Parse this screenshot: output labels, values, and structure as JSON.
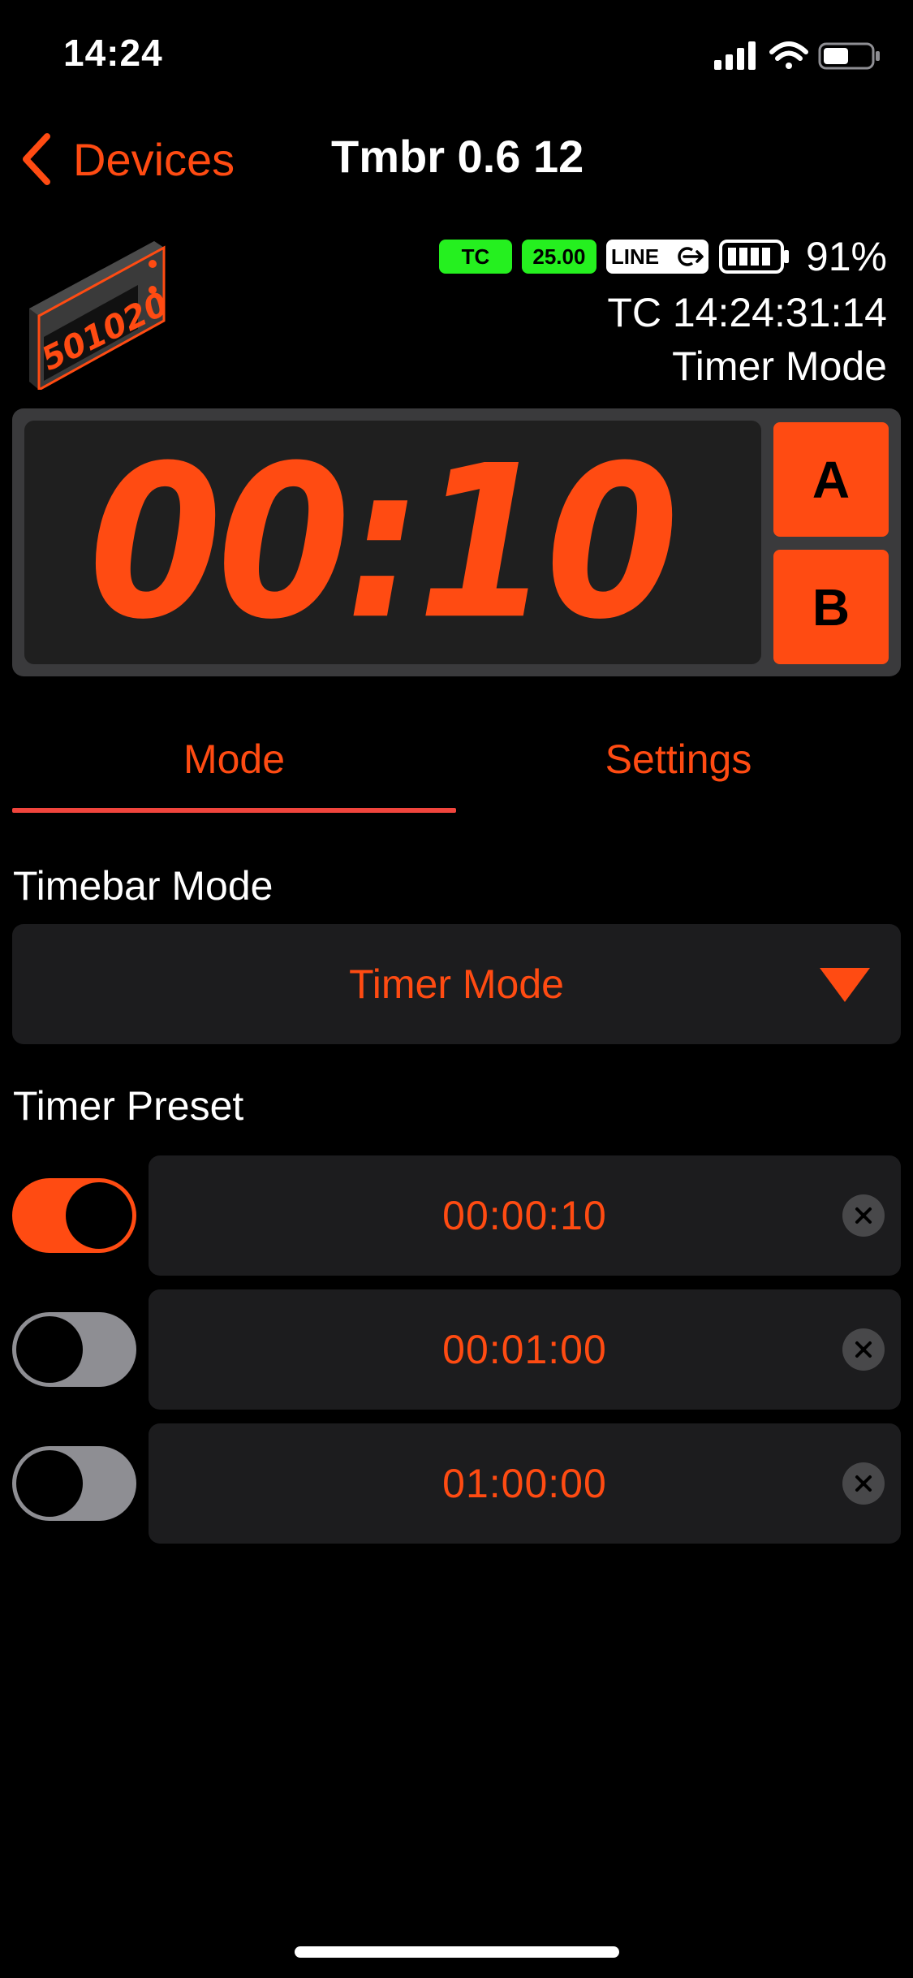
{
  "status_bar": {
    "time": "14:24",
    "icons": [
      "signal-icon",
      "wifi-icon",
      "battery-icon"
    ]
  },
  "nav": {
    "back_label": "Devices",
    "title": "Tmbr 0.6 12"
  },
  "device": {
    "image_readout": "501020",
    "badges": {
      "tc": "TC",
      "fps": "25.00",
      "line": "LINE"
    },
    "battery_percent": "91%",
    "battery_level": 0.91,
    "timecode": "TC 14:24:31:14",
    "mode": "Timer Mode"
  },
  "display": {
    "digits": "00:10",
    "button_a": "A",
    "button_b": "B"
  },
  "tabs": [
    {
      "label": "Mode",
      "active": true
    },
    {
      "label": "Settings",
      "active": false
    }
  ],
  "mode_section": {
    "timebar_label": "Timebar Mode",
    "selected_mode": "Timer Mode",
    "preset_label": "Timer Preset"
  },
  "presets": [
    {
      "value": "00:00:10",
      "enabled": true
    },
    {
      "value": "00:01:00",
      "enabled": false
    },
    {
      "value": "01:00:00",
      "enabled": false
    }
  ],
  "colors": {
    "accent": "#ff4b12",
    "badge_green": "#25f01f",
    "tab_underline": "#f1453d",
    "background": "#000000",
    "field": "#1c1c1e"
  }
}
